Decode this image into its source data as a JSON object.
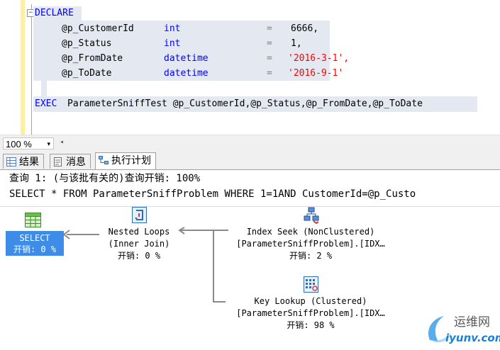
{
  "editor": {
    "collapse_glyph": "−",
    "lines": [
      {
        "kw": "DECLARE"
      },
      {
        "name": "@p_CustomerId",
        "type": "int",
        "eq": "=",
        "value": "6666,"
      },
      {
        "name": "@p_Status",
        "type": "int",
        "eq": "=",
        "value": "1,"
      },
      {
        "name": "@p_FromDate",
        "type": "datetime",
        "eq": "=",
        "value": "'2016-3-1',"
      },
      {
        "name": "@p_ToDate",
        "type": "datetime",
        "eq": "=",
        "value": "'2016-9-1'"
      }
    ],
    "exec_kw": "EXEC",
    "exec_rest": "ParameterSniffTest @p_CustomerId,@p_Status,@p_FromDate,@p_ToDate"
  },
  "zoom": {
    "value": "100 %",
    "arrow": "▾",
    "scroll_left": "◂"
  },
  "tabs": [
    {
      "label": "结果",
      "icon": "grid-icon"
    },
    {
      "label": "消息",
      "icon": "message-icon"
    },
    {
      "label": "执行计划",
      "icon": "execution-plan-icon",
      "active": true
    }
  ],
  "plan": {
    "query_header": "查询 1: (与该批有关的)查询开销: 100%",
    "query_text": "SELECT * FROM ParameterSniffProblem WHERE 1=1AND CustomerId=@p_Custo",
    "select_node": {
      "line1": "SELECT",
      "line2": "开销: 0 %"
    },
    "nested_loops": {
      "line1": "Nested Loops",
      "line2": "(Inner Join)",
      "line3": "开销: 0 %"
    },
    "index_seek": {
      "line1": "Index Seek (NonClustered)",
      "line2": "[ParameterSniffProblem].[IDX…",
      "line3": "开销: 2 %"
    },
    "key_lookup": {
      "line1": "Key Lookup (Clustered)",
      "line2": "[ParameterSniffProblem].[IDX…",
      "line3": "开销: 98 %"
    }
  },
  "watermark": {
    "line1": "运维网",
    "line2": "iyunv.com"
  }
}
